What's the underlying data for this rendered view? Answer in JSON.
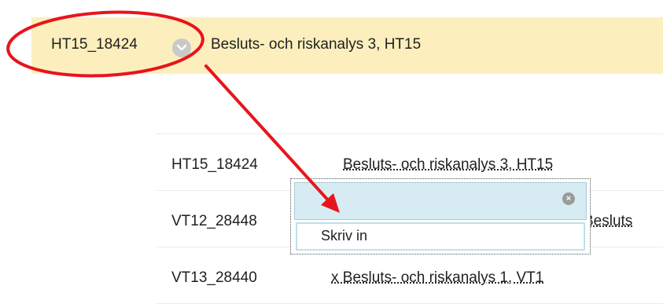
{
  "header": {
    "course_code": "HT15_18424",
    "course_title": "Besluts- och riskanalys 3, HT15"
  },
  "list": {
    "rows": [
      {
        "code": "HT15_18424",
        "title": "Besluts- och riskanalys 3, HT15"
      },
      {
        "code": "VT12_28448",
        "title": "Besluts"
      },
      {
        "code": "VT13_28440",
        "title": "x Besluts- och riskanalys 1, VT1"
      }
    ]
  },
  "popup": {
    "item_label": "Skriv in"
  },
  "annotation": {
    "color": "#e8141c"
  }
}
